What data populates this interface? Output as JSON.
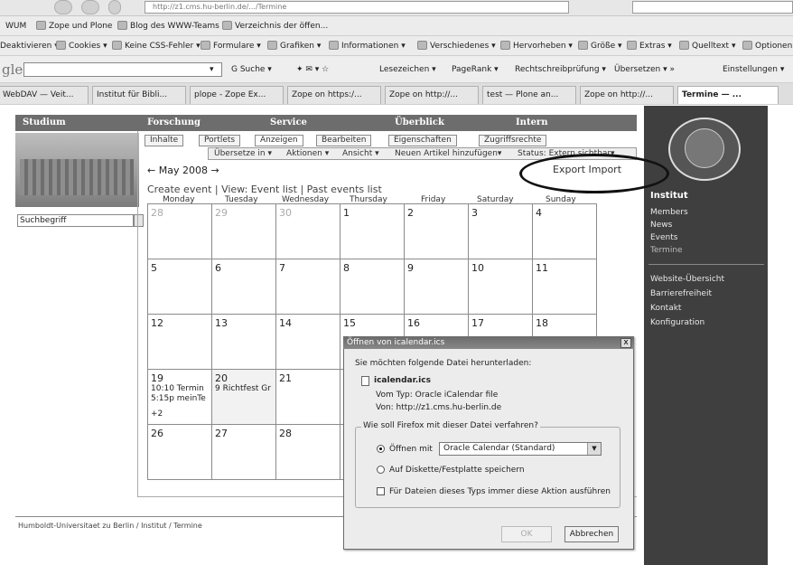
{
  "browser": {
    "address_url": "http://z1.cms.hu-berlin.de/.../Termine",
    "bookmarks": [
      "WUM",
      "Zope und Plone",
      "Blog des WWW-Teams",
      "Verzeichnis der öffen..."
    ],
    "webdev_items": [
      "Deaktivieren ▾",
      "Cookies ▾",
      "Keine CSS-Fehler ▾",
      "Formulare ▾",
      "Grafiken ▾",
      "Informationen ▾",
      "Verschiedenes ▾",
      "Hervorheben ▾",
      "Größe ▾",
      "Extras ▾",
      "Quelltext ▾",
      "Optionen"
    ],
    "google_logo": "gle",
    "google_items": [
      "G Suche ▾",
      "Lesezeichen ▾",
      "PageRank ▾",
      "Rechtschreibprüfung ▾",
      "Übersetzen ▾ »",
      "Einstellungen ▾"
    ],
    "tabs": [
      "WebDAV — Veit...",
      "Institut für Bibli...",
      "plope - Zope Ex...",
      "Zope on https:/...",
      "Zope on http://...",
      "test — Plone an...",
      "Zope on http://...",
      "Termine — ..."
    ]
  },
  "site_nav": [
    "Studium",
    "Forschung",
    "Service",
    "Überblick",
    "Intern"
  ],
  "search": {
    "placeholder": "Suchbegriff"
  },
  "edit_tabs": [
    "Inhalte",
    "Portlets",
    "Anzeigen",
    "Bearbeiten",
    "Eigenschaften",
    "Zugriffsrechte"
  ],
  "actions": [
    "Übersetze in ▾",
    "Aktionen ▾",
    "Ansicht ▾",
    "Neuen Artikel hinzufügen▾",
    "Status: Extern sichtbar▾"
  ],
  "calendar": {
    "month_label": "← May 2008 →",
    "views_label": "Create event | View: Event list | Past events list",
    "export_label": "Export Import",
    "day_names": [
      "Monday",
      "Tuesday",
      "Wednesday",
      "Thursday",
      "Friday",
      "Saturday",
      "Sunday"
    ],
    "weeks": [
      [
        "28",
        "29",
        "30",
        "1",
        "2",
        "3",
        "4"
      ],
      [
        "5",
        "6",
        "7",
        "8",
        "9",
        "10",
        "11"
      ],
      [
        "12",
        "13",
        "14",
        "15",
        "16",
        "17",
        "18"
      ],
      [
        "19",
        "20",
        "21",
        "",
        "",
        "",
        ""
      ],
      [
        "26",
        "27",
        "28",
        "",
        "",
        "",
        ""
      ]
    ],
    "events_19": [
      "10:10 Termin",
      "5:15p meinTe",
      "+2"
    ],
    "events_20": [
      "9 Richtfest Gr"
    ]
  },
  "right_sidebar": {
    "heading": "Institut",
    "links1": [
      "Members",
      "News",
      "Events",
      "Termine"
    ],
    "links2": [
      "Website-Übersicht",
      "Barrierefreiheit",
      "Kontakt",
      "Konfiguration"
    ]
  },
  "footer": "Humboldt-Universitaet zu Berlin / Institut / Termine",
  "dialog": {
    "title": "Öffnen von icalendar.ics",
    "prompt": "Sie möchten folgende Datei herunterladen:",
    "filename": "icalendar.ics",
    "type_line": "Vom Typ: Oracle iCalendar file",
    "from_line": "Von: http://z1.cms.hu-berlin.de",
    "question": "Wie soll Firefox mit dieser Datei verfahren?",
    "open_with": "Öffnen mit",
    "open_with_app": "Oracle Calendar (Standard)",
    "save_disk": "Auf Diskette/Festplatte speichern",
    "always": "Für Dateien dieses Typs immer diese Aktion ausführen",
    "ok": "OK",
    "cancel": "Abbrechen",
    "close": "x"
  }
}
